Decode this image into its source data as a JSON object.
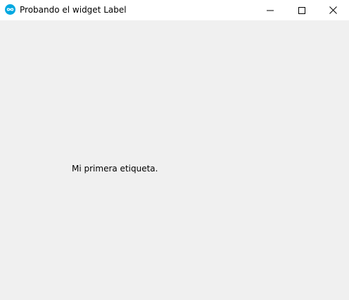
{
  "window": {
    "title": "Probando el widget Label",
    "app_icon": "arduino-infinity-icon",
    "controls": {
      "minimize_icon": "minimize-icon",
      "maximize_icon": "maximize-icon",
      "close_icon": "close-icon"
    }
  },
  "content": {
    "label_text": "Mi primera etiqueta."
  },
  "colors": {
    "titlebar_bg": "#ffffff",
    "client_bg": "#f0f0f0",
    "icon_accent": "#00a8e1"
  }
}
